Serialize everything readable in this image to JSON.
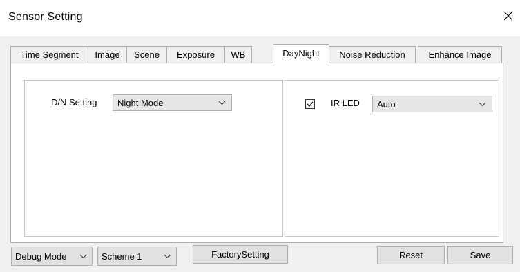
{
  "window": {
    "title": "Sensor Setting",
    "close_icon": "close-icon"
  },
  "tabs": [
    {
      "label": "Time Segment",
      "active": false
    },
    {
      "label": "Image",
      "active": false
    },
    {
      "label": "Scene",
      "active": false
    },
    {
      "label": "Exposure",
      "active": false
    },
    {
      "label": "WB",
      "active": false
    },
    {
      "label": "DayNight",
      "active": true
    },
    {
      "label": "Noise Reduction",
      "active": false
    },
    {
      "label": "Enhance Image",
      "active": false
    }
  ],
  "daynight": {
    "dn_setting_label": "D/N Setting",
    "dn_setting_value": "Night Mode",
    "ir_led_label": "IR LED",
    "ir_led_checked": true,
    "ir_led_value": "Auto"
  },
  "footer": {
    "debug_mode_value": "Debug Mode",
    "scheme_value": "Scheme 1",
    "factory_setting_label": "FactorySetting",
    "reset_label": "Reset",
    "save_label": "Save"
  }
}
